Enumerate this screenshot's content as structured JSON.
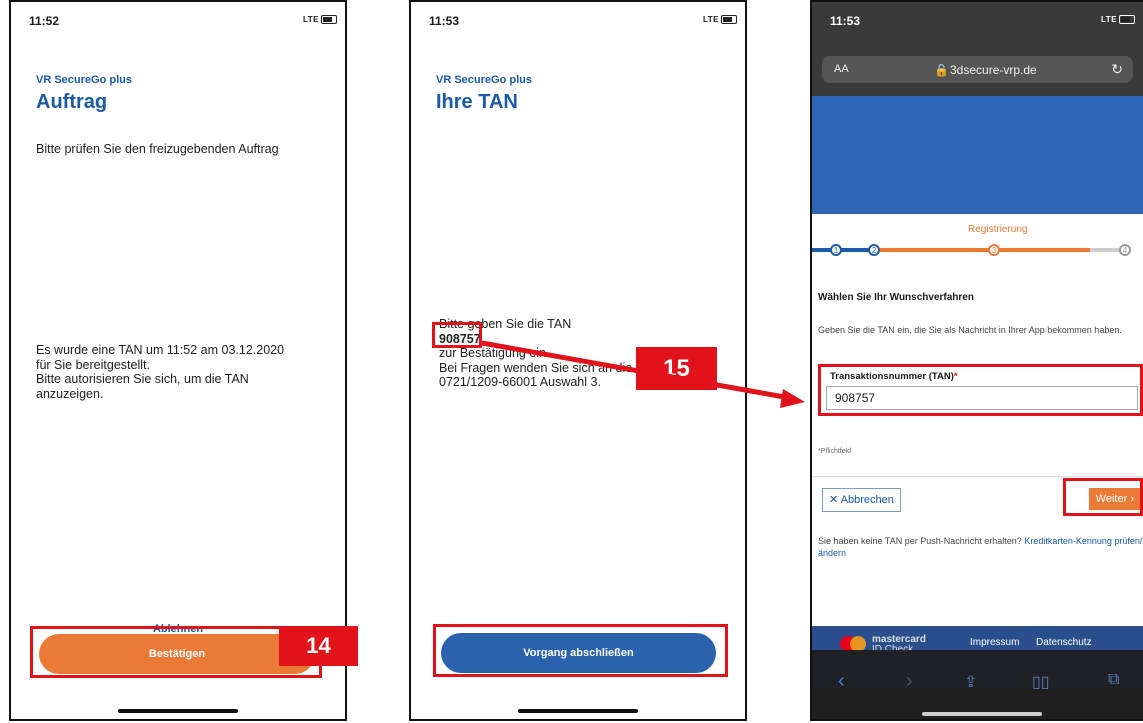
{
  "phone1": {
    "time": "11:52",
    "signal": "LTE",
    "app_name": "VR SecureGo plus",
    "title": "Auftrag",
    "subtitle": "Bitte prüfen Sie den freizugebenden Auftrag",
    "message_lines": [
      "Es wurde eine TAN um 11:52 am 03.12.2020",
      "für Sie bereitgestellt.",
      "Bitte autorisieren Sie sich, um die TAN",
      "anzuzeigen."
    ],
    "reject_link": "Ablehnen",
    "confirm_button": "Bestätigen",
    "badge": "14"
  },
  "phone2": {
    "time": "11:53",
    "signal": "LTE",
    "app_name": "VR SecureGo plus",
    "title": "Ihre TAN",
    "line1": "Bitte geben Sie die TAN",
    "tan": "908757",
    "line2": "zur Bestätigung ein.",
    "line3": "Bei Fragen wenden Sie sich an die",
    "line4": "0721/1209-66001 Auswahl 3.",
    "finish_button": "Vorgang abschließen",
    "badge": "15"
  },
  "phone3": {
    "time": "11:53",
    "signal": "LTE",
    "text_size_label": "AA",
    "url": "3dsecure-vrp.de",
    "step_label": "Registrierung",
    "steps": [
      "1",
      "2",
      "3",
      "4"
    ],
    "heading": "Wählen Sie Ihr Wunschverfahren",
    "instruction": "Geben Sie die TAN ein, die Sie als Nachricht in Ihrer App bekommen haben.",
    "field_label": "Transaktionsnummer (TAN)",
    "field_required_mark": "*",
    "field_value": "908757",
    "required_note": "*Pflichtfeld",
    "cancel_button": "Abbrechen",
    "next_button": "Weiter",
    "help_text": "Sie haben keine TAN per Push-Nachricht erhalten?",
    "help_link": "Kreditkarten-Kennung prüfen/ändern",
    "mc_brand": "mastercard",
    "mc_sub": "ID Check",
    "footer_links": [
      "Impressum",
      "Datenschutz"
    ]
  },
  "colors": {
    "accent_orange": "#ea7a36",
    "brand_blue": "#1a5aa6",
    "button_blue": "#2a62ad",
    "annotation_red": "#e1121a"
  }
}
